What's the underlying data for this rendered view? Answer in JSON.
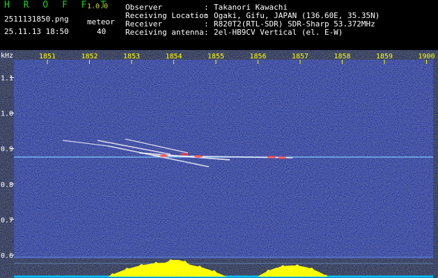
{
  "app": {
    "name": "H R O F F T",
    "version": "1.0.0"
  },
  "file": {
    "name": "2511131850.png",
    "datetime": "25.11.13 18:50"
  },
  "meteor": {
    "label": "meteor",
    "count": "40"
  },
  "station": [
    {
      "key": "Observer",
      "sep": ":",
      "value": "Takanori Kawachi"
    },
    {
      "key": "Receiving Location",
      "sep": ":",
      "value": "Ogaki, Gifu, JAPAN (136.60E, 35.35N)"
    },
    {
      "key": "Receiver",
      "sep": ":",
      "value": "R820T2(RTL-SDR) SDR-Sharp 53.372MHz"
    },
    {
      "key": "Receiving antenna",
      "sep": ":",
      "value": "2el-HB9CV Vertical (el. E-W)"
    }
  ],
  "axis": {
    "y_unit": "kHz",
    "time_ticks": [
      "1851",
      "1852",
      "1853",
      "1854",
      "1855",
      "1856",
      "1857",
      "1858",
      "1859",
      "1900"
    ],
    "freq_ticks": [
      "1.1",
      "1.0",
      "0.9",
      "0.8",
      "0.7",
      "0.6"
    ],
    "freq_range_khz": [
      0.59,
      1.15
    ]
  },
  "colors": {
    "background": "#000000",
    "noise_base": "#0d1a8c",
    "carrier_line": "#7ec8ff",
    "meteor_echo": "#ffffff",
    "echo_hot": "#ff3c3c",
    "power_bar": "#ffff00",
    "power_baseline": "#00c0ff",
    "tick_label": "#ffff00",
    "text": "#ffffff",
    "title": "#19d219"
  }
}
